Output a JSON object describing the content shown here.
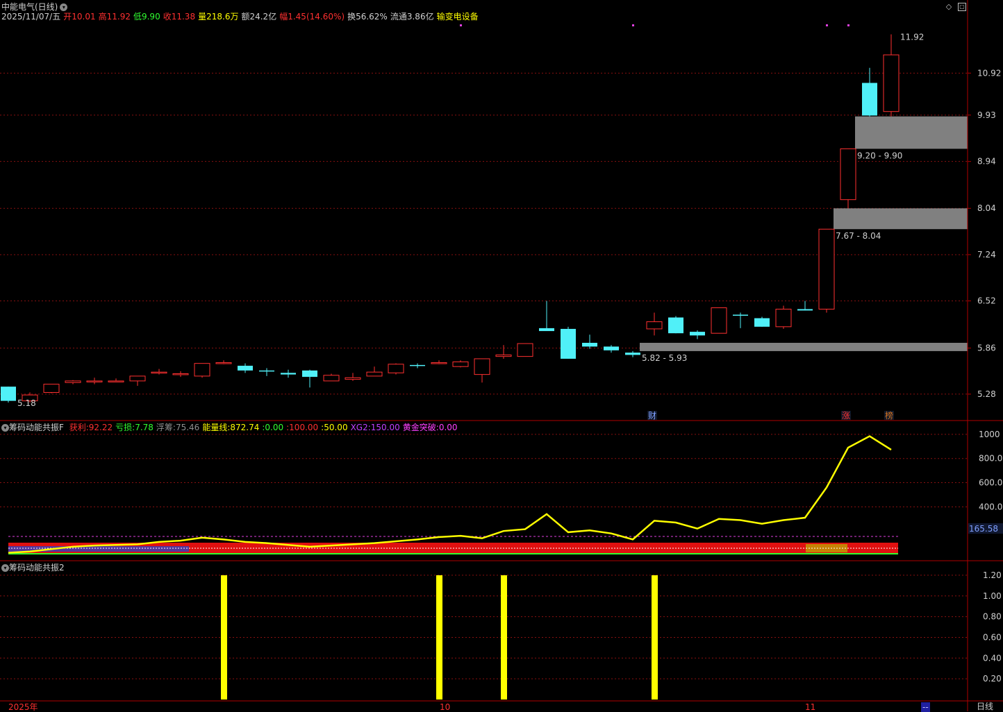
{
  "header": {
    "title": "中能电气(日线)",
    "date": "2025/11/07/五",
    "open_label": "开",
    "open": "10.01",
    "high_label": "高",
    "high": "11.92",
    "low_label": "低",
    "low": "9.90",
    "close_label": "收",
    "close": "11.38",
    "volume_label": "量",
    "volume": "218.6万",
    "amount_label": "额",
    "amount": "24.2亿",
    "change_label": "幅",
    "change": "1.45(14.60%)",
    "turnover_label": "换",
    "turnover": "56.62%",
    "float_label": "流通",
    "float": "3.86亿",
    "sector": "输变电设备"
  },
  "indicator1": {
    "name": "筹码动能共振F",
    "items": [
      {
        "label": "获利:",
        "value": "92.22",
        "color": "#ff3030"
      },
      {
        "label": "亏损:",
        "value": "7.78",
        "color": "#30ff30"
      },
      {
        "label": "浮筹:",
        "value": "75.46",
        "color": "#909090"
      },
      {
        "label": "能量线:",
        "value": "872.74",
        "color": "#ffff00"
      },
      {
        "label": ":",
        "value": "0.00",
        "color": "#30ff30"
      },
      {
        "label": ":",
        "value": "100.00",
        "color": "#ff3030"
      },
      {
        "label": ":",
        "value": "50.00",
        "color": "#ffff00"
      },
      {
        "label": "XG2:",
        "value": "150.00",
        "color": "#c040ff"
      },
      {
        "label": "黄金突破:",
        "value": "0.00",
        "color": "#ff40ff"
      }
    ],
    "axis_ticks": [
      "1000",
      "800.0",
      "600.0",
      "400.0"
    ],
    "current_marker": "165.58"
  },
  "indicator2": {
    "name": "筹码动能共振2",
    "axis_ticks": [
      "1.20",
      "1.00",
      "0.80",
      "0.60",
      "0.40",
      "0.20"
    ]
  },
  "main_axis_ticks": [
    "10.92",
    "9.93",
    "8.94",
    "8.04",
    "7.24",
    "6.52",
    "5.86",
    "5.28"
  ],
  "annotations": {
    "high_label": "11.92",
    "low_label": "5.18",
    "zones": [
      {
        "low": 9.2,
        "high": 9.9,
        "label": "9.20 - 9.90"
      },
      {
        "low": 7.67,
        "high": 8.04,
        "label": "7.67 - 8.04"
      },
      {
        "low": 5.82,
        "high": 5.93,
        "label": "5.82 - 5.93"
      }
    ],
    "event_markers": [
      "财",
      "涨",
      "榜"
    ]
  },
  "time_axis": {
    "labels": [
      "2025年",
      "10",
      "11"
    ],
    "period_label": "日线",
    "mode_label": "--"
  },
  "colors": {
    "up": "#ff3030",
    "down": "#50f0f8",
    "grid": "#8a1010",
    "zone": "#808080",
    "energy": "#ffff00",
    "background": "#000000"
  },
  "chart_data": [
    {
      "type": "candlestick",
      "title": "中能电气(日线)",
      "ylim": [
        5.1,
        12.1
      ],
      "y_scale": "log",
      "candles": [
        {
          "o": 5.37,
          "h": 5.37,
          "l": 5.18,
          "c": 5.2
        },
        {
          "o": 5.2,
          "h": 5.3,
          "l": 5.18,
          "c": 5.27
        },
        {
          "o": 5.3,
          "h": 5.4,
          "l": 5.29,
          "c": 5.4
        },
        {
          "o": 5.42,
          "h": 5.45,
          "l": 5.4,
          "c": 5.44
        },
        {
          "o": 5.44,
          "h": 5.48,
          "l": 5.4,
          "c": 5.44
        },
        {
          "o": 5.44,
          "h": 5.47,
          "l": 5.43,
          "c": 5.44
        },
        {
          "o": 5.44,
          "h": 5.5,
          "l": 5.38,
          "c": 5.5
        },
        {
          "o": 5.55,
          "h": 5.59,
          "l": 5.52,
          "c": 5.55
        },
        {
          "o": 5.52,
          "h": 5.56,
          "l": 5.49,
          "c": 5.53
        },
        {
          "o": 5.5,
          "h": 5.66,
          "l": 5.48,
          "c": 5.66
        },
        {
          "o": 5.67,
          "h": 5.7,
          "l": 5.65,
          "c": 5.67
        },
        {
          "o": 5.63,
          "h": 5.66,
          "l": 5.54,
          "c": 5.57
        },
        {
          "o": 5.57,
          "h": 5.6,
          "l": 5.5,
          "c": 5.56
        },
        {
          "o": 5.54,
          "h": 5.58,
          "l": 5.48,
          "c": 5.52
        },
        {
          "o": 5.57,
          "h": 5.58,
          "l": 5.36,
          "c": 5.49
        },
        {
          "o": 5.44,
          "h": 5.53,
          "l": 5.44,
          "c": 5.51
        },
        {
          "o": 5.46,
          "h": 5.54,
          "l": 5.44,
          "c": 5.48
        },
        {
          "o": 5.5,
          "h": 5.62,
          "l": 5.5,
          "c": 5.55
        },
        {
          "o": 5.54,
          "h": 5.66,
          "l": 5.52,
          "c": 5.65
        },
        {
          "o": 5.64,
          "h": 5.66,
          "l": 5.6,
          "c": 5.63
        },
        {
          "o": 5.66,
          "h": 5.7,
          "l": 5.65,
          "c": 5.67
        },
        {
          "o": 5.62,
          "h": 5.7,
          "l": 5.61,
          "c": 5.68
        },
        {
          "o": 5.52,
          "h": 5.72,
          "l": 5.42,
          "c": 5.72
        },
        {
          "o": 5.75,
          "h": 5.9,
          "l": 5.72,
          "c": 5.77
        },
        {
          "o": 5.75,
          "h": 5.92,
          "l": 5.75,
          "c": 5.92
        },
        {
          "o": 6.13,
          "h": 6.52,
          "l": 6.1,
          "c": 6.09
        },
        {
          "o": 6.12,
          "h": 6.15,
          "l": 5.72,
          "c": 5.72
        },
        {
          "o": 5.93,
          "h": 6.04,
          "l": 5.85,
          "c": 5.88
        },
        {
          "o": 5.88,
          "h": 5.9,
          "l": 5.8,
          "c": 5.83
        },
        {
          "o": 5.8,
          "h": 5.82,
          "l": 5.74,
          "c": 5.77
        },
        {
          "o": 6.12,
          "h": 6.35,
          "l": 6.03,
          "c": 6.22
        },
        {
          "o": 6.28,
          "h": 6.3,
          "l": 6.06,
          "c": 6.06
        },
        {
          "o": 6.08,
          "h": 6.1,
          "l": 5.98,
          "c": 6.03
        },
        {
          "o": 6.06,
          "h": 6.42,
          "l": 6.06,
          "c": 6.42
        },
        {
          "o": 6.32,
          "h": 6.35,
          "l": 6.13,
          "c": 6.31
        },
        {
          "o": 6.27,
          "h": 6.29,
          "l": 6.15,
          "c": 6.15
        },
        {
          "o": 6.15,
          "h": 6.45,
          "l": 6.12,
          "c": 6.4
        },
        {
          "o": 6.4,
          "h": 6.52,
          "l": 6.38,
          "c": 6.38
        },
        {
          "o": 6.4,
          "h": 7.67,
          "l": 6.35,
          "c": 7.67
        },
        {
          "o": 8.2,
          "h": 9.2,
          "l": 8.04,
          "c": 9.2
        },
        {
          "o": 10.68,
          "h": 11.05,
          "l": 9.9,
          "c": 9.92
        },
        {
          "o": 10.01,
          "h": 11.92,
          "l": 9.9,
          "c": 11.38
        }
      ]
    },
    {
      "type": "line",
      "title": "筹码动能共振F",
      "series": [
        {
          "name": "能量线",
          "values": [
            20,
            30,
            50,
            70,
            80,
            85,
            90,
            110,
            120,
            145,
            130,
            110,
            100,
            85,
            70,
            80,
            90,
            100,
            115,
            130,
            150,
            160,
            140,
            200,
            215,
            340,
            190,
            205,
            180,
            130,
            285,
            270,
            220,
            300,
            290,
            260,
            290,
            310,
            560,
            890,
            985,
            872.74
          ]
        }
      ],
      "ylim": [
        0,
        1080
      ]
    },
    {
      "type": "bar",
      "title": "筹码动能共振2",
      "signal_indices": [
        10,
        20,
        23,
        30
      ],
      "values": [
        1.2,
        1.2,
        1.2,
        1.2
      ],
      "ylim": [
        0,
        1.3
      ]
    }
  ]
}
